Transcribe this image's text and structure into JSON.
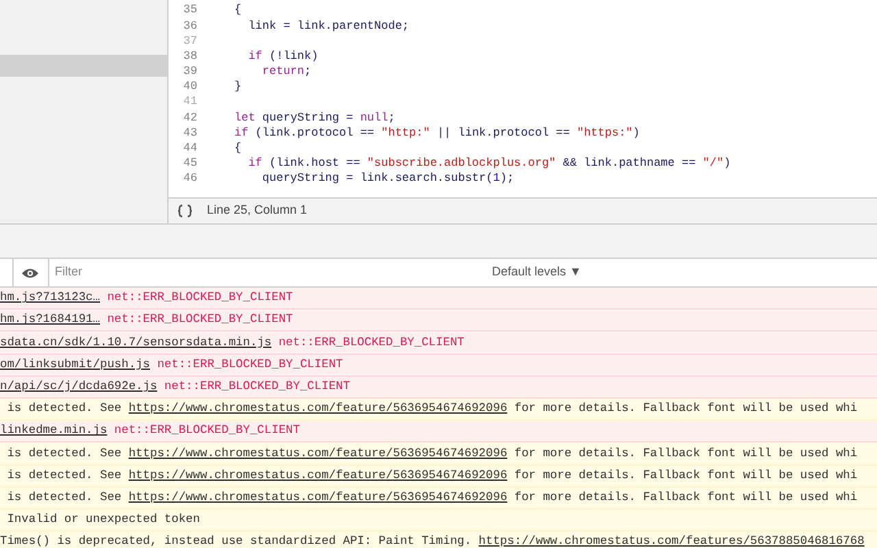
{
  "navigator": {
    "rows": [
      {
        "selected": false
      },
      {
        "selected": false
      },
      {
        "selected": false
      },
      {
        "selected": true
      },
      {
        "selected": false
      },
      {
        "selected": false
      }
    ]
  },
  "editor": {
    "lines": [
      {
        "number": "35",
        "tokens": [
          {
            "kind": "plain",
            "text": "{"
          }
        ]
      },
      {
        "number": "36",
        "tokens": [
          {
            "kind": "plain",
            "text": "  link = link.parentNode;"
          }
        ]
      },
      {
        "number": "37"
      },
      {
        "number": "38",
        "tokens": [
          {
            "kind": "keyword",
            "text": "  if"
          },
          {
            "kind": "plain",
            "text": " (!link)"
          }
        ]
      },
      {
        "number": "39",
        "tokens": [
          {
            "kind": "keyword",
            "text": "    return"
          },
          {
            "kind": "plain",
            "text": ";"
          }
        ]
      },
      {
        "number": "40",
        "tokens": [
          {
            "kind": "plain",
            "text": "}"
          }
        ]
      },
      {
        "number": "41"
      },
      {
        "number": "42",
        "tokens": [
          {
            "kind": "keyword",
            "text": "let"
          },
          {
            "kind": "plain",
            "text": " queryString = "
          },
          {
            "kind": "keyword",
            "text": "null"
          },
          {
            "kind": "plain",
            "text": ";"
          }
        ]
      },
      {
        "number": "43",
        "tokens": [
          {
            "kind": "keyword",
            "text": "if"
          },
          {
            "kind": "plain",
            "text": " (link.protocol == "
          },
          {
            "kind": "string",
            "text": "\"http:\""
          },
          {
            "kind": "plain",
            "text": " || link.protocol == "
          },
          {
            "kind": "string",
            "text": "\"https:\""
          },
          {
            "kind": "plain",
            "text": ")"
          }
        ]
      },
      {
        "number": "44",
        "tokens": [
          {
            "kind": "plain",
            "text": "{"
          }
        ]
      },
      {
        "number": "45",
        "tokens": [
          {
            "kind": "keyword",
            "text": "  if"
          },
          {
            "kind": "plain",
            "text": " (link.host == "
          },
          {
            "kind": "string",
            "text": "\"subscribe.adblockplus.org\""
          },
          {
            "kind": "plain",
            "text": " && link.pathname == "
          },
          {
            "kind": "string",
            "text": "\"/\""
          },
          {
            "kind": "plain",
            "text": ")"
          }
        ]
      },
      {
        "number": "46",
        "tokens": [
          {
            "kind": "plain",
            "text": "    queryString = link.search.substr("
          },
          {
            "kind": "number",
            "text": "1"
          },
          {
            "kind": "plain",
            "text": ");"
          }
        ]
      }
    ],
    "status": "Line 25, Column 1"
  },
  "console": {
    "filter": {
      "placeholder": "Filter"
    },
    "levels": "Default levels ▼",
    "messages": [
      {
        "kind": "error",
        "link": "hm.js?713123c…",
        "text": " net::ERR_BLOCKED_BY_CLIENT"
      },
      {
        "kind": "error",
        "link": "hm.js?1684191…",
        "text": " net::ERR_BLOCKED_BY_CLIENT"
      },
      {
        "kind": "error",
        "link": "sdata.cn/sdk/1.10.7/sensorsdata.min.js",
        "text": " net::ERR_BLOCKED_BY_CLIENT"
      },
      {
        "kind": "error",
        "link": "om/linksubmit/push.js",
        "text": " net::ERR_BLOCKED_BY_CLIENT"
      },
      {
        "kind": "error",
        "link": "n/api/sc/j/dcda692e.js",
        "text": " net::ERR_BLOCKED_BY_CLIENT"
      },
      {
        "kind": "warning",
        "prefix": " is detected. See ",
        "link": "https://www.chromestatus.com/feature/5636954674692096",
        "text": " for more details. Fallback font will be used whi"
      },
      {
        "kind": "error",
        "link": "linkedme.min.js",
        "text": " net::ERR_BLOCKED_BY_CLIENT"
      },
      {
        "kind": "warning",
        "prefix": " is detected. See ",
        "link": "https://www.chromestatus.com/feature/5636954674692096",
        "text": " for more details. Fallback font will be used whi"
      },
      {
        "kind": "warning",
        "prefix": " is detected. See ",
        "link": "https://www.chromestatus.com/feature/5636954674692096",
        "text": " for more details. Fallback font will be used whi"
      },
      {
        "kind": "warning",
        "prefix": " is detected. See ",
        "link": "https://www.chromestatus.com/feature/5636954674692096",
        "text": " for more details. Fallback font will be used whi"
      },
      {
        "kind": "warning",
        "prefix": " Invalid or unexpected token"
      },
      {
        "kind": "warning",
        "prefix": "Times() is deprecated, instead use standardized API: Paint Timing. ",
        "link": "https://www.chromestatus.com/features/5637885046816768"
      }
    ]
  }
}
